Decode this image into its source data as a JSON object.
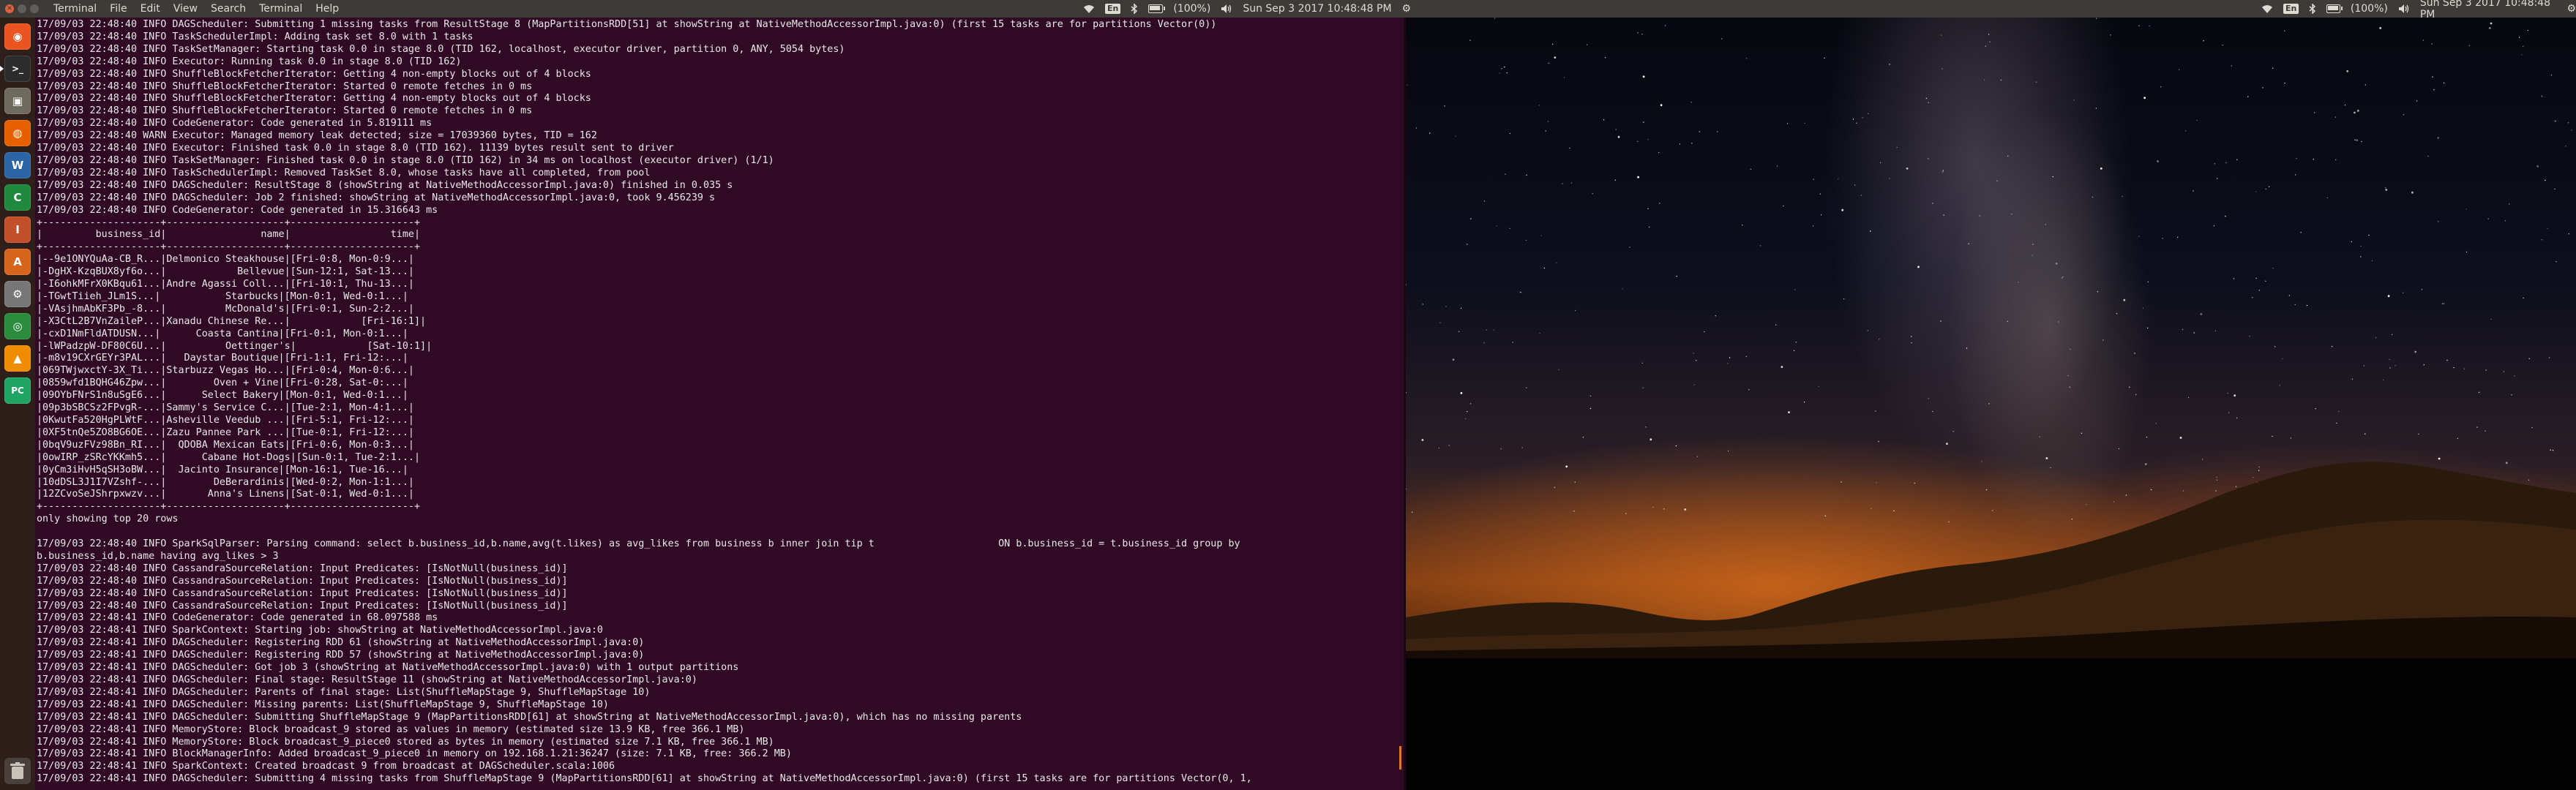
{
  "menubar": {
    "app_name": "Terminal",
    "menus": [
      "File",
      "Edit",
      "View",
      "Search",
      "Terminal",
      "Help"
    ],
    "indicators": [
      {
        "id": "kbd",
        "label": "En"
      },
      {
        "id": "battery",
        "label": "(100%)"
      },
      {
        "id": "clock",
        "label": "Sun Sep  3 2017 10:48:48 PM"
      }
    ]
  },
  "launcher": {
    "apps": [
      {
        "name": "ubuntu-dash",
        "glyph": "◉",
        "color": "#e95420"
      },
      {
        "name": "terminal",
        "glyph": ">_",
        "color": "#2c2c2c"
      },
      {
        "name": "files",
        "glyph": "▣",
        "color": "#6e6a5e"
      },
      {
        "name": "firefox",
        "glyph": "◍",
        "color": "#e66000"
      },
      {
        "name": "libreoffice-writer",
        "glyph": "W",
        "color": "#2b65a6"
      },
      {
        "name": "libreoffice-calc",
        "glyph": "C",
        "color": "#1f8a3d"
      },
      {
        "name": "libreoffice-impress",
        "glyph": "I",
        "color": "#c2502b"
      },
      {
        "name": "software-center",
        "glyph": "A",
        "color": "#d7641d"
      },
      {
        "name": "settings",
        "glyph": "⚙",
        "color": "#777"
      },
      {
        "name": "chrome",
        "glyph": "◎",
        "color": "#2a8c3c"
      },
      {
        "name": "vlc",
        "glyph": "▲",
        "color": "#f08c00"
      },
      {
        "name": "pycharm",
        "glyph": "PC",
        "color": "#20a464"
      }
    ]
  },
  "terminal": {
    "lines": [
      "17/09/03 22:48:40 INFO DAGScheduler: Submitting 1 missing tasks from ResultStage 8 (MapPartitionsRDD[51] at showString at NativeMethodAccessorImpl.java:0) (first 15 tasks are for partitions Vector(0))",
      "17/09/03 22:48:40 INFO TaskSchedulerImpl: Adding task set 8.0 with 1 tasks",
      "17/09/03 22:48:40 INFO TaskSetManager: Starting task 0.0 in stage 8.0 (TID 162, localhost, executor driver, partition 0, ANY, 5054 bytes)",
      "17/09/03 22:48:40 INFO Executor: Running task 0.0 in stage 8.0 (TID 162)",
      "17/09/03 22:48:40 INFO ShuffleBlockFetcherIterator: Getting 4 non-empty blocks out of 4 blocks",
      "17/09/03 22:48:40 INFO ShuffleBlockFetcherIterator: Started 0 remote fetches in 0 ms",
      "17/09/03 22:48:40 INFO ShuffleBlockFetcherIterator: Getting 4 non-empty blocks out of 4 blocks",
      "17/09/03 22:48:40 INFO ShuffleBlockFetcherIterator: Started 0 remote fetches in 0 ms",
      "17/09/03 22:48:40 INFO CodeGenerator: Code generated in 5.819111 ms",
      "17/09/03 22:48:40 WARN Executor: Managed memory leak detected; size = 17039360 bytes, TID = 162",
      "17/09/03 22:48:40 INFO Executor: Finished task 0.0 in stage 8.0 (TID 162). 11139 bytes result sent to driver",
      "17/09/03 22:48:40 INFO TaskSetManager: Finished task 0.0 in stage 8.0 (TID 162) in 34 ms on localhost (executor driver) (1/1)",
      "17/09/03 22:48:40 INFO TaskSchedulerImpl: Removed TaskSet 8.0, whose tasks have all completed, from pool",
      "17/09/03 22:48:40 INFO DAGScheduler: ResultStage 8 (showString at NativeMethodAccessorImpl.java:0) finished in 0.035 s",
      "17/09/03 22:48:40 INFO DAGScheduler: Job 2 finished: showString at NativeMethodAccessorImpl.java:0, took 9.456239 s",
      "17/09/03 22:48:40 INFO CodeGenerator: Code generated in 15.316643 ms",
      "+--------------------+--------------------+---------------------+",
      "|         business_id|                name|                 time|",
      "+--------------------+--------------------+---------------------+",
      "|--9e1ONYQuAa-CB_R...|Delmonico Steakhouse|[Fri-0:8, Mon-0:9...|",
      "|-DgHX-KzqBUX8yf6o...|            Bellevue|[Sun-12:1, Sat-13...|",
      "|-I6ohkMFrX0KBqu61...|Andre Agassi Coll...|[Fri-10:1, Thu-13...|",
      "|-TGwtTiieh_JLm1S...|           Starbucks|[Mon-0:1, Wed-0:1...|",
      "|-VAsjhmAbKF3Pb_-8...|          McDonald's|[Fri-0:1, Sun-2:2...|",
      "|-X3CtL2B7VnZaileP...|Xanadu Chinese Re...|            [Fri-16:1]|",
      "|-cxD1NmFldATDUSN...|      Coasta Cantina|[Fri-0:1, Mon-0:1...|",
      "|-lWPadzpW-DF80C6U...|          Oettinger's|            [Sat-10:1]|",
      "|-m8v19CXrGEYr3PAL...|   Daystar Boutique|[Fri-1:1, Fri-12:...|",
      "|069TWjwxctY-3X_Ti...|Starbuzz Vegas Ho...|[Fri-0:4, Mon-0:6...|",
      "|0859wfd1BQHG46Zpw...|        Oven + Vine|[Fri-0:28, Sat-0:...|",
      "|09OYbFNrS1n8uSgE6...|      Select Bakery|[Mon-0:1, Wed-0:1...|",
      "|09p3bSBCSz2FPvgR-...|Sammy's Service C...|[Tue-2:1, Mon-4:1...|",
      "|0KwutFa520HgPLWtF...|Asheville Veedub ...|[Fri-5:1, Fri-12:...|",
      "|0XF5tnQe5ZO8BG6OE...|Zazu Pannee Park ...|[Tue-0:1, Fri-12:...|",
      "|0bqV9uzFVz98Bn_RI...|  QDOBA Mexican Eats|[Fri-0:6, Mon-0:3...|",
      "|0owIRP_zSRcYKKmh5...|      Cabane Hot-Dogs|[Sun-0:1, Tue-2:1...|",
      "|0yCm3iHvH5qSH3oBW...|  Jacinto Insurance|[Mon-16:1, Tue-16...|",
      "|10dDSL3J1I7VZshf-...|        DeBerardinis|[Wed-0:2, Mon-1:1...|",
      "|12ZCvoSeJShrpxwzv...|       Anna's Linens|[Sat-0:1, Wed-0:1...|",
      "+--------------------+--------------------+---------------------+",
      "only showing top 20 rows",
      "",
      "17/09/03 22:48:40 INFO SparkSqlParser: Parsing command: select b.business_id,b.name,avg(t.likes) as avg_likes from business b inner join tip t                     ON b.business_id = t.business_id group by",
      "b.business_id,b.name having avg_likes > 3",
      "17/09/03 22:48:40 INFO CassandraSourceRelation: Input Predicates: [IsNotNull(business_id)]",
      "17/09/03 22:48:40 INFO CassandraSourceRelation: Input Predicates: [IsNotNull(business_id)]",
      "17/09/03 22:48:40 INFO CassandraSourceRelation: Input Predicates: [IsNotNull(business_id)]",
      "17/09/03 22:48:40 INFO CassandraSourceRelation: Input Predicates: [IsNotNull(business_id)]",
      "17/09/03 22:48:41 INFO CodeGenerator: Code generated in 68.097588 ms",
      "17/09/03 22:48:41 INFO SparkContext: Starting job: showString at NativeMethodAccessorImpl.java:0",
      "17/09/03 22:48:41 INFO DAGScheduler: Registering RDD 61 (showString at NativeMethodAccessorImpl.java:0)",
      "17/09/03 22:48:41 INFO DAGScheduler: Registering RDD 57 (showString at NativeMethodAccessorImpl.java:0)",
      "17/09/03 22:48:41 INFO DAGScheduler: Got job 3 (showString at NativeMethodAccessorImpl.java:0) with 1 output partitions",
      "17/09/03 22:48:41 INFO DAGScheduler: Final stage: ResultStage 11 (showString at NativeMethodAccessorImpl.java:0)",
      "17/09/03 22:48:41 INFO DAGScheduler: Parents of final stage: List(ShuffleMapStage 9, ShuffleMapStage 10)",
      "17/09/03 22:48:41 INFO DAGScheduler: Missing parents: List(ShuffleMapStage 9, ShuffleMapStage 10)",
      "17/09/03 22:48:41 INFO DAGScheduler: Submitting ShuffleMapStage 9 (MapPartitionsRDD[61] at showString at NativeMethodAccessorImpl.java:0), which has no missing parents",
      "17/09/03 22:48:41 INFO MemoryStore: Block broadcast_9 stored as values in memory (estimated size 13.9 KB, free 366.1 MB)",
      "17/09/03 22:48:41 INFO MemoryStore: Block broadcast_9_piece0 stored as bytes in memory (estimated size 7.1 KB, free 366.1 MB)",
      "17/09/03 22:48:41 INFO BlockManagerInfo: Added broadcast_9_piece0 in memory on 192.168.1.21:36247 (size: 7.1 KB, free: 366.2 MB)",
      "17/09/03 22:48:41 INFO SparkContext: Created broadcast 9 from broadcast at DAGScheduler.scala:1006",
      "17/09/03 22:48:41 INFO DAGScheduler: Submitting 4 missing tasks from ShuffleMapStage 9 (MapPartitionsRDD[61] at showString at NativeMethodAccessorImpl.java:0) (first 15 tasks are for partitions Vector(0, 1,"
    ]
  },
  "theme": {
    "terminal_bg": "#300a24",
    "menubar_bg": "#3c3b37",
    "accent": "#e95420"
  }
}
